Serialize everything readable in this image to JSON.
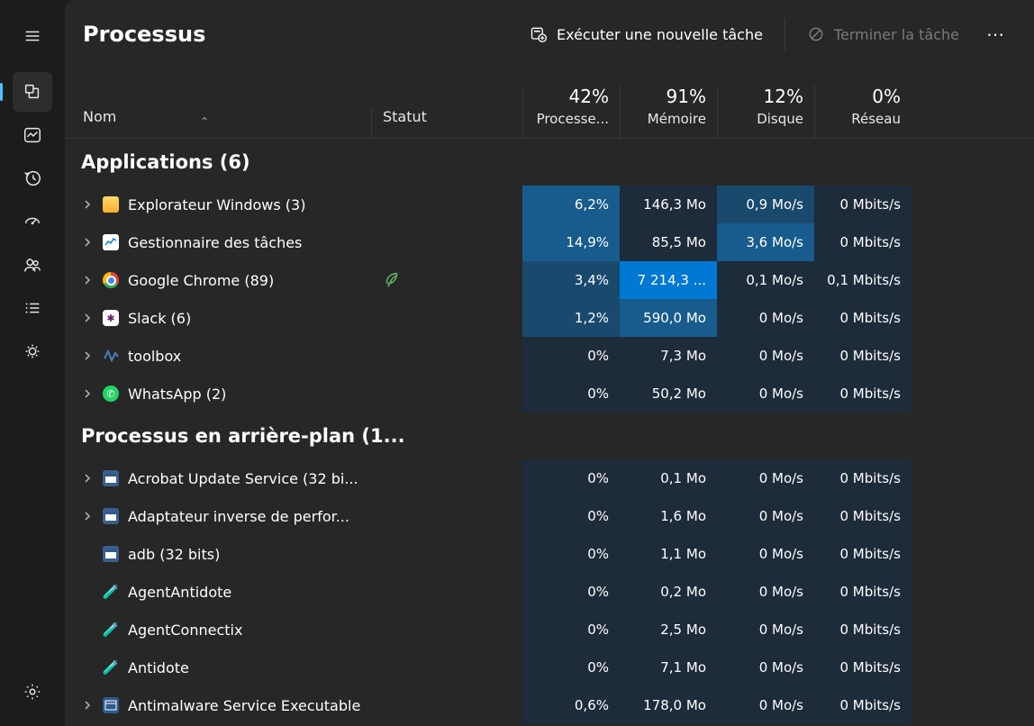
{
  "title": "Processus",
  "toolbar": {
    "new_task": "Exécuter une nouvelle tâche",
    "end_task": "Terminer la tâche",
    "more": "⋯"
  },
  "columns": {
    "name": "Nom",
    "status": "Statut",
    "cpu_pct": "42%",
    "cpu_lbl": "Processe...",
    "mem_pct": "91%",
    "mem_lbl": "Mémoire",
    "disk_pct": "12%",
    "disk_lbl": "Disque",
    "net_pct": "0%",
    "net_lbl": "Réseau"
  },
  "groups": [
    {
      "title": "Applications (6)",
      "rows": [
        {
          "expand": true,
          "icon": "folder",
          "name": "Explorateur Windows (3)",
          "leaf": false,
          "eco": false,
          "cpu": {
            "v": "6,2%",
            "h": 2
          },
          "mem": {
            "v": "146,3 Mo",
            "h": 0
          },
          "disk": {
            "v": "0,9 Mo/s",
            "h": 1
          },
          "net": {
            "v": "0 Mbits/s",
            "h": 0
          }
        },
        {
          "expand": true,
          "icon": "taskmgr",
          "name": "Gestionnaire des tâches",
          "leaf": false,
          "eco": false,
          "cpu": {
            "v": "14,9%",
            "h": 2
          },
          "mem": {
            "v": "85,5 Mo",
            "h": 0
          },
          "disk": {
            "v": "3,6 Mo/s",
            "h": 2
          },
          "net": {
            "v": "0 Mbits/s",
            "h": 0
          }
        },
        {
          "expand": true,
          "icon": "chrome",
          "name": "Google Chrome (89)",
          "leaf": false,
          "eco": true,
          "cpu": {
            "v": "3,4%",
            "h": 1
          },
          "mem": {
            "v": "7 214,3 ...",
            "h": 3
          },
          "disk": {
            "v": "0,1 Mo/s",
            "h": 0
          },
          "net": {
            "v": "0,1 Mbits/s",
            "h": 0
          }
        },
        {
          "expand": true,
          "icon": "slack",
          "name": "Slack (6)",
          "leaf": false,
          "eco": false,
          "cpu": {
            "v": "1,2%",
            "h": 1
          },
          "mem": {
            "v": "590,0 Mo",
            "h": 2
          },
          "disk": {
            "v": "0 Mo/s",
            "h": 0
          },
          "net": {
            "v": "0 Mbits/s",
            "h": 0
          }
        },
        {
          "expand": true,
          "icon": "toolbox",
          "name": "toolbox",
          "leaf": false,
          "eco": false,
          "cpu": {
            "v": "0%",
            "h": 0
          },
          "mem": {
            "v": "7,3 Mo",
            "h": 0
          },
          "disk": {
            "v": "0 Mo/s",
            "h": 0
          },
          "net": {
            "v": "0 Mbits/s",
            "h": 0
          }
        },
        {
          "expand": true,
          "icon": "whatsapp",
          "name": "WhatsApp (2)",
          "leaf": false,
          "eco": false,
          "cpu": {
            "v": "0%",
            "h": 0
          },
          "mem": {
            "v": "50,2 Mo",
            "h": 0
          },
          "disk": {
            "v": "0 Mo/s",
            "h": 0
          },
          "net": {
            "v": "0 Mbits/s",
            "h": 0
          }
        }
      ]
    },
    {
      "title": "Processus en arrière-plan (1...",
      "rows": [
        {
          "expand": true,
          "icon": "generic",
          "name": "Acrobat Update Service (32 bi...",
          "leaf": false,
          "eco": false,
          "cpu": {
            "v": "0%",
            "h": 0
          },
          "mem": {
            "v": "0,1 Mo",
            "h": 0
          },
          "disk": {
            "v": "0 Mo/s",
            "h": 0
          },
          "net": {
            "v": "0 Mbits/s",
            "h": 0
          }
        },
        {
          "expand": true,
          "icon": "generic",
          "name": "Adaptateur inverse de perfor...",
          "leaf": false,
          "eco": false,
          "cpu": {
            "v": "0%",
            "h": 0
          },
          "mem": {
            "v": "1,6 Mo",
            "h": 0
          },
          "disk": {
            "v": "0 Mo/s",
            "h": 0
          },
          "net": {
            "v": "0 Mbits/s",
            "h": 0
          }
        },
        {
          "expand": false,
          "icon": "generic",
          "name": "adb (32 bits)",
          "leaf": true,
          "eco": false,
          "cpu": {
            "v": "0%",
            "h": 0
          },
          "mem": {
            "v": "1,1 Mo",
            "h": 0
          },
          "disk": {
            "v": "0 Mo/s",
            "h": 0
          },
          "net": {
            "v": "0 Mbits/s",
            "h": 0
          }
        },
        {
          "expand": false,
          "icon": "flask",
          "name": "AgentAntidote",
          "leaf": true,
          "eco": false,
          "cpu": {
            "v": "0%",
            "h": 0
          },
          "mem": {
            "v": "0,2 Mo",
            "h": 0
          },
          "disk": {
            "v": "0 Mo/s",
            "h": 0
          },
          "net": {
            "v": "0 Mbits/s",
            "h": 0
          }
        },
        {
          "expand": false,
          "icon": "flask",
          "name": "AgentConnectix",
          "leaf": true,
          "eco": false,
          "cpu": {
            "v": "0%",
            "h": 0
          },
          "mem": {
            "v": "2,5 Mo",
            "h": 0
          },
          "disk": {
            "v": "0 Mo/s",
            "h": 0
          },
          "net": {
            "v": "0 Mbits/s",
            "h": 0
          }
        },
        {
          "expand": false,
          "icon": "flask",
          "name": "Antidote",
          "leaf": true,
          "eco": false,
          "cpu": {
            "v": "0%",
            "h": 0
          },
          "mem": {
            "v": "7,1 Mo",
            "h": 0
          },
          "disk": {
            "v": "0 Mo/s",
            "h": 0
          },
          "net": {
            "v": "0 Mbits/s",
            "h": 0
          }
        },
        {
          "expand": true,
          "icon": "window",
          "name": "Antimalware Service Executable",
          "leaf": false,
          "eco": false,
          "cpu": {
            "v": "0,6%",
            "h": 0
          },
          "mem": {
            "v": "178,0 Mo",
            "h": 0
          },
          "disk": {
            "v": "0 Mo/s",
            "h": 0
          },
          "net": {
            "v": "0 Mbits/s",
            "h": 0
          }
        }
      ]
    }
  ],
  "icons": {
    "toolbox_glyph": "〰",
    "slack_glyph": "✱",
    "whatsapp_glyph": "✆",
    "flask_glyph": "🧪",
    "taskmgr_glyph": "📊"
  }
}
